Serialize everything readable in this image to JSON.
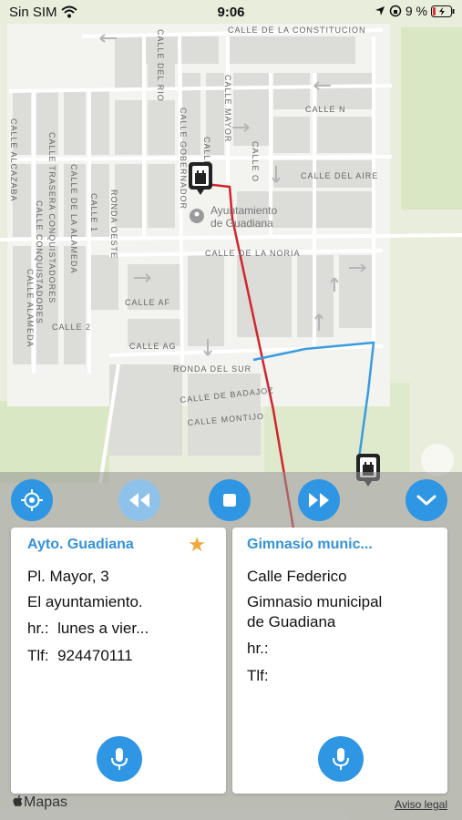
{
  "status": {
    "carrier": "Sin SIM",
    "time": "9:06",
    "battery": "9 %"
  },
  "map": {
    "landmark": "Ayuntamiento de Guadiana",
    "landmark_line1": "Ayuntamiento",
    "landmark_line2": "de Guadiana",
    "streets": {
      "constitucion": "CALLE DE LA CONSTITUCION",
      "del_rio": "CALLE DEL RIO",
      "calle_n": "CALLE N",
      "calle_mayor": "CALLE MAYOR",
      "gobernador": "CALLE GOBERNADOR",
      "calle_o": "CALLE O",
      "del_aire": "CALLE DEL AIRE",
      "alcazaba": "CALLE ALCAZABA",
      "trasera": "CALLE TRASERA CONQUISTADORES",
      "alameda1": "CALLE DE LA ALAMEDA",
      "conquistadores": "CALLE CONQUISTADORES",
      "calle1": "CALLE 1",
      "ronda_oeste": "RONDA OESTE",
      "noria": "CALLE DE LA NORIA",
      "calle_af": "CALLE AF",
      "calle_2": "CALLE 2",
      "alameda2": "CALLE ALAMEDA",
      "calle_ag": "CALLE AG",
      "ronda_sur": "RONDA DEL SUR",
      "badajoz": "CALLE DE BADAJOZ",
      "montijo": "CALLE MONTIJO"
    },
    "attribution": "Mapas",
    "legal": "Aviso legal"
  },
  "controls": [
    "locate-icon",
    "rewind-icon",
    "stop-icon",
    "fast-forward-icon",
    "chevron-down-icon"
  ],
  "cards": [
    {
      "title": "Ayto. Guadiana",
      "favorite": true,
      "address": "Pl. Mayor, 3",
      "description": "El ayuntamiento.",
      "hours_label": "hr.:",
      "hours_value": "lunes a vier...",
      "phone_label": "Tlf:",
      "phone_value": "924470111"
    },
    {
      "title": "Gimnasio munic...",
      "favorite": false,
      "address": "Calle Federico",
      "description_line1": "Gimnasio municipal",
      "description_line2": "de Guadiana",
      "hours_label": "hr.:",
      "phone_label": "Tlf:"
    }
  ],
  "colors": {
    "accent": "#2f96e4",
    "title": "#3592d9",
    "star": "#f0a73a",
    "route_red": "#d0262e",
    "route_blue": "#3b9be0"
  }
}
